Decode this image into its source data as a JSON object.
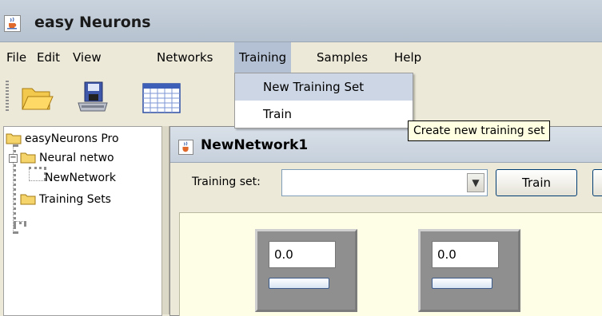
{
  "window": {
    "title": "easy Neurons",
    "app_icon": "java-cup-icon"
  },
  "menubar": {
    "items": [
      {
        "label": "File"
      },
      {
        "label": "Edit"
      },
      {
        "label": "View"
      },
      {
        "label": "Networks"
      },
      {
        "label": "Training"
      },
      {
        "label": "Samples"
      },
      {
        "label": "Help"
      }
    ],
    "open_menu": "Training"
  },
  "toolbar": {
    "icons": [
      "open-folder-icon",
      "save-disk-icon",
      "grid-table-icon"
    ]
  },
  "training_menu": {
    "items": [
      {
        "label": "New Training Set",
        "highlighted": true
      },
      {
        "label": "Train",
        "highlighted": false
      }
    ],
    "tooltip": "Create new training set"
  },
  "tree": {
    "root": "easyNeurons Pro",
    "neural_networks": "Neural netwo",
    "network_leaf": "NewNetwork",
    "training_sets": "Training Sets"
  },
  "frame": {
    "title": "NewNetwork1",
    "training_set_label": "Training set:",
    "training_set_value": "",
    "train_button": "Train",
    "neurons": [
      {
        "value": "0.0"
      },
      {
        "value": "0.0"
      }
    ]
  },
  "colors": {
    "menu_highlight": "#b4c1d4",
    "tooltip_bg": "#ffffe1",
    "canvas_bg": "#fefee6",
    "neuron_bg": "#8f8f8f"
  }
}
